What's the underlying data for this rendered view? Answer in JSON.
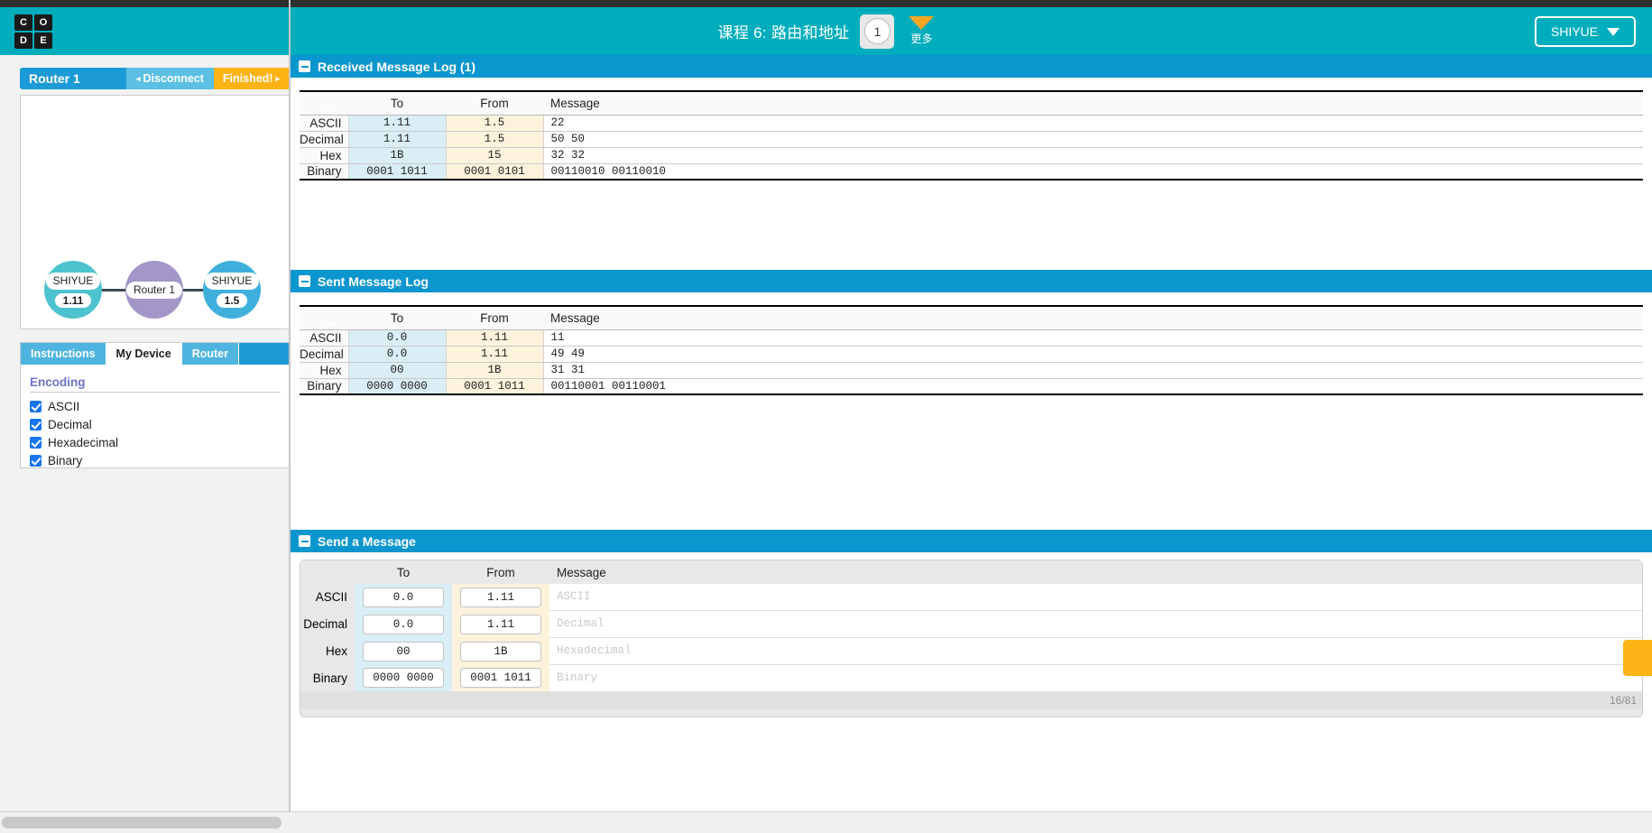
{
  "header": {
    "logo_letters": [
      "C",
      "O",
      "D",
      "E"
    ],
    "lesson_title": "课程 6: 路由和地址",
    "level_number": "1",
    "more_label": "更多",
    "user_name": "SHIYUE"
  },
  "device_bar": {
    "device_name": "Router 1",
    "disconnect_label": "Disconnect",
    "disconnect_arrow": "◂",
    "finished_label": "Finished!",
    "finished_arrow": "▸"
  },
  "network": {
    "nodes": [
      {
        "label": "SHIYUE",
        "ip": "1.11",
        "color": "#4cc3ce"
      },
      {
        "label": "Router 1",
        "ip": "",
        "color": "#a396c8"
      },
      {
        "label": "SHIYUE",
        "ip": "1.5",
        "color": "#3fb0dd"
      }
    ]
  },
  "tabs": [
    {
      "label": "Instructions",
      "active": false
    },
    {
      "label": "My Device",
      "active": true
    },
    {
      "label": "Router",
      "active": false
    }
  ],
  "encoding": {
    "title": "Encoding",
    "options": [
      {
        "label": "ASCII",
        "checked": true
      },
      {
        "label": "Decimal",
        "checked": true
      },
      {
        "label": "Hexadecimal",
        "checked": true
      },
      {
        "label": "Binary",
        "checked": true
      }
    ]
  },
  "received_log": {
    "title": "Received Message Log (1)",
    "columns": [
      "",
      "To",
      "From",
      "Message"
    ],
    "rows": [
      {
        "label": "ASCII",
        "to": "1.11",
        "from": "1.5",
        "message": "22"
      },
      {
        "label": "Decimal",
        "to": "1.11",
        "from": "1.5",
        "message": "50 50"
      },
      {
        "label": "Hex",
        "to": "1B",
        "from": "15",
        "message": "32 32"
      },
      {
        "label": "Binary",
        "to": "0001 1011",
        "from": "0001 0101",
        "message": "00110010 00110010"
      }
    ]
  },
  "sent_log": {
    "title": "Sent Message Log",
    "columns": [
      "",
      "To",
      "From",
      "Message"
    ],
    "rows": [
      {
        "label": "ASCII",
        "to": "0.0",
        "from": "1.11",
        "message": "11"
      },
      {
        "label": "Decimal",
        "to": "0.0",
        "from": "1.11",
        "message": "49 49"
      },
      {
        "label": "Hex",
        "to": "00",
        "from": "1B",
        "message": "31 31"
      },
      {
        "label": "Binary",
        "to": "0000 0000",
        "from": "0001 1011",
        "message": "00110001 00110001"
      }
    ]
  },
  "send_message": {
    "title": "Send a Message",
    "columns": [
      "",
      "To",
      "From",
      "Message"
    ],
    "rows": [
      {
        "label": "ASCII",
        "to": "0.0",
        "from": "1.11",
        "placeholder": "ASCII"
      },
      {
        "label": "Decimal",
        "to": "0.0",
        "from": "1.11",
        "placeholder": "Decimal"
      },
      {
        "label": "Hex",
        "to": "00",
        "from": "1B",
        "placeholder": "Hexadecimal"
      },
      {
        "label": "Binary",
        "to": "0000 0000",
        "from": "0001 1011",
        "placeholder": "Binary"
      }
    ],
    "counter": "16/81"
  },
  "colors": {
    "header_teal": "#00adbc",
    "panel_blue": "#0c96ce",
    "device_blue": "#1c9ad6",
    "orange": "#fcb316",
    "to_cell": "#daeef6",
    "from_cell": "#fdf3dc"
  }
}
